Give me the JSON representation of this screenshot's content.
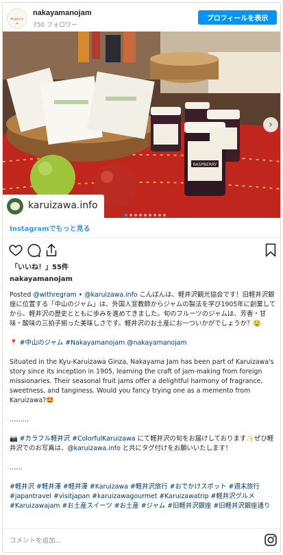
{
  "header": {
    "account_name": "nakayamanojam",
    "followers": "750 フォロワー",
    "profile_button": "プロフィールを表示",
    "avatar_text": "中山のジャム"
  },
  "photo": {
    "tag_account": "karuizawa.info",
    "jar_label": "RASPBERRY",
    "dots_count": 9,
    "active_dot": 0
  },
  "more_link": "Instagramでもっと見る",
  "likes": "「いいね！」55件",
  "post_username": "nakayamanojam",
  "caption": {
    "p1_prefix": "Posted ",
    "p1_mention1": "@withregram",
    "p1_bullet": " • ",
    "p1_mention2": "@karuizawa.info",
    "p1_text": " こんばんは、軽井沢観光協会です！旧軽井沢銀座に位置する「中山のジャム」は、外国人宣教師からジャムの製法を学び1905年に創業してから、軽井沢の歴史とともに歩みを進めてきました。旬のフルーツのジャムは、芳香・甘味・酸味の三拍子揃った美味しさです。軽井沢のお土産にお一ついかがでしょうか？🤤",
    "p2_pin": "📍 ",
    "p2_hashtag": "#中山のジャム",
    "p2_space": " ",
    "p2_link1": "#Nakayamanojam",
    "p2_space2": " ",
    "p2_link2": "@nakayamanojam",
    "p3": "Situated in the Kyu-Karuizawa Ginza, Nakayama Jam has been part of Karuizawa's story since its inception in 1905, learning the craft of jam-making from foreign missionaries. Their seasonal fruit jams offer a delightful harmony of fragrance, sweetness, and tanginess. Would you fancy trying one as a memento from Karuizawa?🤩",
    "p4": "………",
    "p5_camera": "📷 ",
    "p5_tag1": "#カラフル軽井沢",
    "p5_space": " ",
    "p5_tag2": "#ColorfulKaruizawa",
    "p5_text1": " にて軽井沢の旬をお届けしております✨ぜひ軽井沢でのお写真は、",
    "p5_mention": "@karuizawa.info",
    "p5_text2": " と共にタグ付けをお願いいたします！",
    "p6": "……",
    "hashtags": "#軽井沢 #軽井澤 #軽井澤 #Karuizawa #軽井沢旅行 #おでかけスポット #週末旅行 #japantravel #visitjapan #karuizawagourmet #Karuizawatrip #軽井沢グルメ #Karuizawajam #お土産スイーツ #お土産 #ジャム #旧軽井沢銀座 #旧軽井沢銀座通り"
  },
  "comment": {
    "placeholder": "コメントを追加..."
  },
  "colors": {
    "accent": "#0095f6",
    "link": "#00376b",
    "more_link": "#3897f0"
  },
  "icons": [
    "heart-icon",
    "comment-icon",
    "share-icon",
    "bookmark-icon",
    "chevron-right-icon",
    "instagram-icon"
  ]
}
